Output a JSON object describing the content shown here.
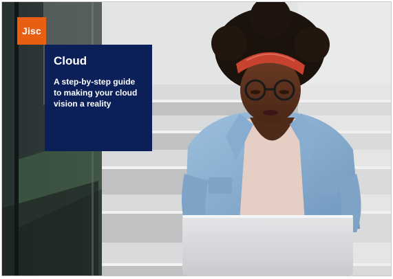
{
  "cover": {
    "logo_text": "Jisc",
    "title": "Cloud",
    "subtitle": "A step-by-step guide to making your cloud vision a reality"
  },
  "colors": {
    "logo_orange": "#e85e13",
    "panel_navy": "#0b2058",
    "text_white": "#ffffff"
  },
  "photo": {
    "subject_icon": "woman-with-laptop-on-stairs"
  }
}
